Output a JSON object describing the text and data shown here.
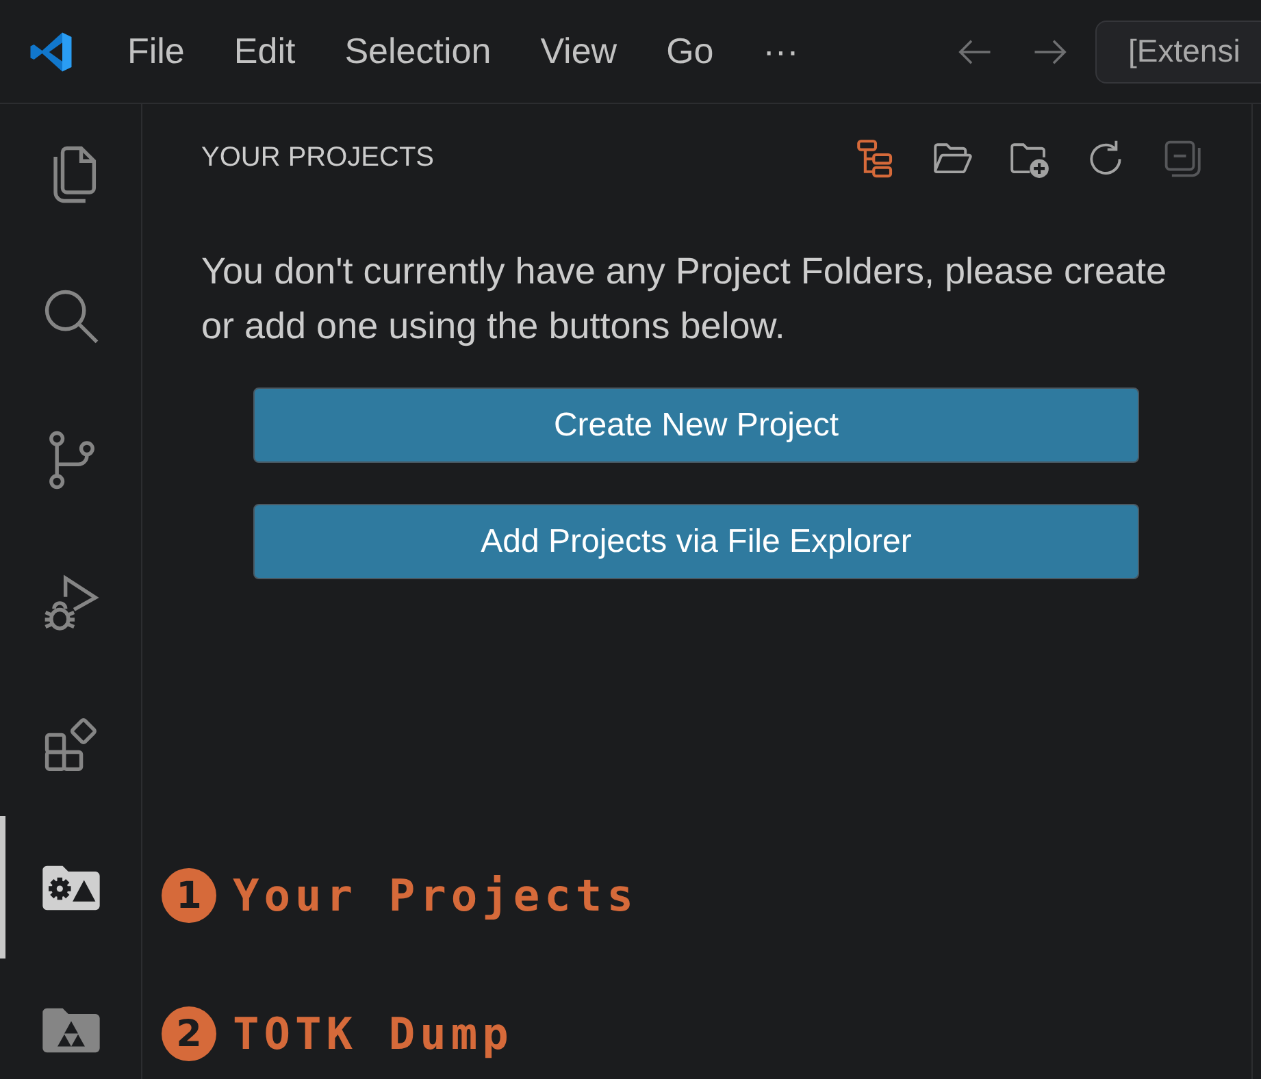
{
  "title_bar": {
    "menu": [
      {
        "label": "File"
      },
      {
        "label": "Edit"
      },
      {
        "label": "Selection"
      },
      {
        "label": "View"
      },
      {
        "label": "Go"
      },
      {
        "label": "···"
      }
    ],
    "command_center": {
      "text": "[Extensi"
    }
  },
  "activity_bar": {
    "items": [
      {
        "kind": "files",
        "selected": false
      },
      {
        "kind": "search",
        "selected": false
      },
      {
        "kind": "branch",
        "selected": false
      },
      {
        "kind": "debug",
        "selected": false
      },
      {
        "kind": "extensions",
        "selected": false
      },
      {
        "kind": "projects",
        "selected": true
      },
      {
        "kind": "dump",
        "selected": false
      }
    ]
  },
  "sidebar": {
    "title": "YOUR PROJECTS",
    "actions": [
      {
        "kind": "tree",
        "disabled": false
      },
      {
        "kind": "open-folder",
        "disabled": false
      },
      {
        "kind": "add-folder",
        "disabled": false
      },
      {
        "kind": "refresh",
        "disabled": false
      },
      {
        "kind": "collapse",
        "disabled": true
      }
    ],
    "message": "You don't currently have any Project Folders, please create or add one using the buttons below.",
    "buttons": [
      {
        "label": "Create New Project"
      },
      {
        "label": "Add Projects via File Explorer"
      }
    ]
  },
  "annotations": [
    {
      "number": "1",
      "label": "Your Projects"
    },
    {
      "number": "2",
      "label": "TOTK Dump"
    }
  ]
}
